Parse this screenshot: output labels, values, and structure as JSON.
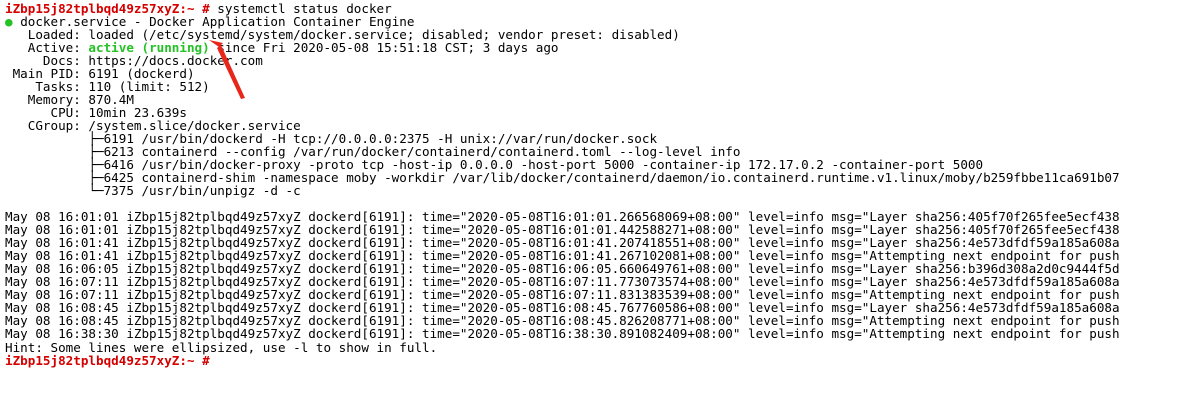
{
  "terminal": {
    "prompt": "iZbp15j82tplbqd49z57xyZ:~ #",
    "command": " systemctl status docker",
    "service_line": "docker.service - Docker Application Container Engine",
    "status_bullet": "●",
    "loaded": "   Loaded: loaded (/etc/systemd/system/docker.service; disabled; vendor preset: disabled)",
    "active_label": "   Active: ",
    "active_value": "active (running)",
    "active_rest": " since Fri 2020-05-08 15:51:18 CST; 3 days ago",
    "docs": "     Docs: https://docs.docker.com",
    "main_pid": " Main PID: 6191 (dockerd)",
    "tasks": "    Tasks: 110 (limit: 512)",
    "memory": "   Memory: 870.4M",
    "cpu": "      CPU: 10min 23.639s",
    "cgroup": "   CGroup: /system.slice/docker.service",
    "processes": [
      "           ├─6191 /usr/bin/dockerd -H tcp://0.0.0.0:2375 -H unix://var/run/docker.sock",
      "           ├─6213 containerd --config /var/run/docker/containerd/containerd.toml --log-level info",
      "           ├─6416 /usr/bin/docker-proxy -proto tcp -host-ip 0.0.0.0 -host-port 5000 -container-ip 172.17.0.2 -container-port 5000",
      "           ├─6425 containerd-shim -namespace moby -workdir /var/lib/docker/containerd/daemon/io.containerd.runtime.v1.linux/moby/b259fbbe11ca691b07",
      "           └─7375 /usr/bin/unpigz -d -c"
    ],
    "logs": [
      "May 08 16:01:01 iZbp15j82tplbqd49z57xyZ dockerd[6191]: time=\"2020-05-08T16:01:01.266568069+08:00\" level=info msg=\"Layer sha256:405f70f265fee5ecf438",
      "May 08 16:01:01 iZbp15j82tplbqd49z57xyZ dockerd[6191]: time=\"2020-05-08T16:01:01.442588271+08:00\" level=info msg=\"Layer sha256:405f70f265fee5ecf438",
      "May 08 16:01:41 iZbp15j82tplbqd49z57xyZ dockerd[6191]: time=\"2020-05-08T16:01:41.207418551+08:00\" level=info msg=\"Layer sha256:4e573dfdf59a185a608a",
      "May 08 16:01:41 iZbp15j82tplbqd49z57xyZ dockerd[6191]: time=\"2020-05-08T16:01:41.267102081+08:00\" level=info msg=\"Attempting next endpoint for push",
      "May 08 16:06:05 iZbp15j82tplbqd49z57xyZ dockerd[6191]: time=\"2020-05-08T16:06:05.660649761+08:00\" level=info msg=\"Layer sha256:b396d308a2d0c9444f5d",
      "May 08 16:07:11 iZbp15j82tplbqd49z57xyZ dockerd[6191]: time=\"2020-05-08T16:07:11.773073574+08:00\" level=info msg=\"Layer sha256:4e573dfdf59a185a608a",
      "May 08 16:07:11 iZbp15j82tplbqd49z57xyZ dockerd[6191]: time=\"2020-05-08T16:07:11.831383539+08:00\" level=info msg=\"Attempting next endpoint for push",
      "May 08 16:08:45 iZbp15j82tplbqd49z57xyZ dockerd[6191]: time=\"2020-05-08T16:08:45.767760586+08:00\" level=info msg=\"Layer sha256:4e573dfdf59a185a608a",
      "May 08 16:08:45 iZbp15j82tplbqd49z57xyZ dockerd[6191]: time=\"2020-05-08T16:08:45.826208771+08:00\" level=info msg=\"Attempting next endpoint for push",
      "May 08 16:38:30 iZbp15j82tplbqd49z57xyZ dockerd[6191]: time=\"2020-05-08T16:38:30.891082409+08:00\" level=info msg=\"Attempting next endpoint for push"
    ],
    "hint": "Hint: Some lines were ellipsized, use -l to show in full.",
    "final_prompt": "iZbp15j82tplbqd49z57xyZ:~ #"
  },
  "colors": {
    "prompt": "#d40000",
    "active": "#25c225",
    "annotation_arrow": "#e8271b"
  }
}
